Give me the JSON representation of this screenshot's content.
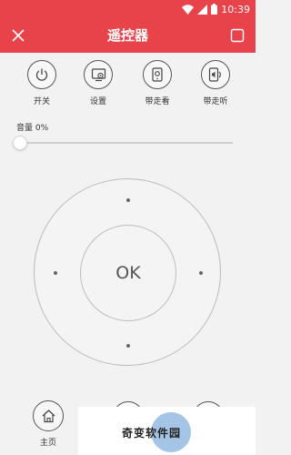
{
  "status_bar": {
    "time": "10:39"
  },
  "header": {
    "title": "遥控器"
  },
  "functions": [
    {
      "label": "开关",
      "icon": "power-icon"
    },
    {
      "label": "设置",
      "icon": "settings-icon"
    },
    {
      "label": "带走看",
      "icon": "phone-watch-icon"
    },
    {
      "label": "带走听",
      "icon": "phone-listen-icon"
    }
  ],
  "volume": {
    "label": "音量 0%",
    "level": 0
  },
  "dpad": {
    "ok_label": "OK"
  },
  "bottom_nav": {
    "home_label": "主页"
  },
  "watermark": {
    "text": "奇变软件园"
  },
  "colors": {
    "accent": "#e8434b",
    "background": "#f2f2f2"
  }
}
